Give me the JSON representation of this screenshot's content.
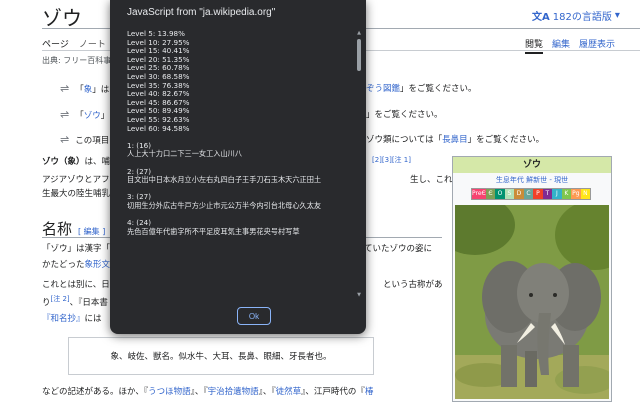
{
  "wiki": {
    "title": "ゾウ",
    "languages": "182の言語版",
    "tabs_left": [
      "ページ",
      "ノート"
    ],
    "tabs_right": [
      "閲覧",
      "編集",
      "履歴表示"
    ],
    "source": "出典: フリー百科事典",
    "hatnotes": [
      {
        "prefix": "「",
        "link": "象",
        "suffix": "」は"
      },
      {
        "prefix": "「",
        "link": "ゾウ",
        "suffix": "」は"
      },
      {
        "prefix": "この項目",
        "link": "",
        "suffix": ""
      }
    ],
    "hatnote_right": [
      {
        "link": "ぞう図鑑",
        "suffix": "」をご覧ください。"
      },
      {
        "text": "」をご覧ください。"
      },
      {
        "pre": "ゾウ類については「",
        "link": "長鼻目",
        "suffix": "」をご覧ください。"
      }
    ],
    "intro": {
      "lead_bold": "ゾウ",
      "lead_paren": "（象）",
      "lead_rest": "は、哺",
      "refs": "[2][3][注 1]",
      "line2_left": "アジアゾウとアフ",
      "line2_right": "生し、これらは現",
      "line3_left": "生最大の陸生哺乳"
    },
    "section": {
      "heading": "名称",
      "edit": "[ 編集 ]"
    },
    "naming": {
      "line1_left": "「ゾウ」は漢字「",
      "line1_right": "ていたゾウの姿に",
      "line2_left": "かたどった",
      "line2_link": "象形文",
      "line3_left": "これとは別に、日",
      "line3_right": "という古称があ",
      "line4_left": "り",
      "line4_ref": "[注 2]",
      "line4_mid": "、『日本書",
      "line5_link": "『和名抄』",
      "line5_rest": "には"
    },
    "quote": "象、岐佐、獣名。似水牛、大耳、長鼻、眼細、牙長者也。",
    "bottom": {
      "text1": "などの記述がある。ほか、『",
      "link1": "うつほ物語",
      "text2": "』、『",
      "link2": "宇治拾遺物語",
      "text3": "』、『",
      "link3": "徒然草",
      "text4": "』、江戸時代の『",
      "link4": "椿"
    },
    "infobox": {
      "title": "ゾウ",
      "links": "生息年代  鮮新世 - 現世",
      "status": [
        "PreЄ",
        "Є",
        "O",
        "S",
        "D",
        "C",
        "P",
        "T",
        "J",
        "K",
        "Pg",
        "N"
      ],
      "status_colors": [
        "#f74370",
        "#7fa056",
        "#009270",
        "#b3e1b6",
        "#cb8c37",
        "#67a599",
        "#f04028",
        "#812b92",
        "#34b2c9",
        "#7fc64e",
        "#fd9a52",
        "#ffe619"
      ]
    }
  },
  "dialog": {
    "title": "JavaScript from \"ja.wikipedia.org\"",
    "lines": [
      "Level 5: 13.98%",
      "Level 10: 27.95%",
      "Level 15: 40.41%",
      "Level 20: 51.35%",
      "Level 25: 60.78%",
      "Level 30: 68.58%",
      "Level 35: 76.38%",
      "Level 40: 82.67%",
      "Level 45: 86.67%",
      "Level 50: 89.49%",
      "Level 55: 92.63%",
      "Level 60: 94.58%",
      "",
      "1: (16)",
      "人上大十力口二下三一女工入山川八",
      "",
      "2: (27)",
      "目文出中日本水月立小左右丸四白子王手刀石玉木天六正田土",
      "",
      "3: (27)",
      "切用生分外広古牛戸方少止市元公万半今内引台北母心久太友",
      "",
      "4: (24)",
      "先色百億年代歯字所不平足皮耳気主事男花央号村写草"
    ],
    "ok_label": "Ok"
  }
}
